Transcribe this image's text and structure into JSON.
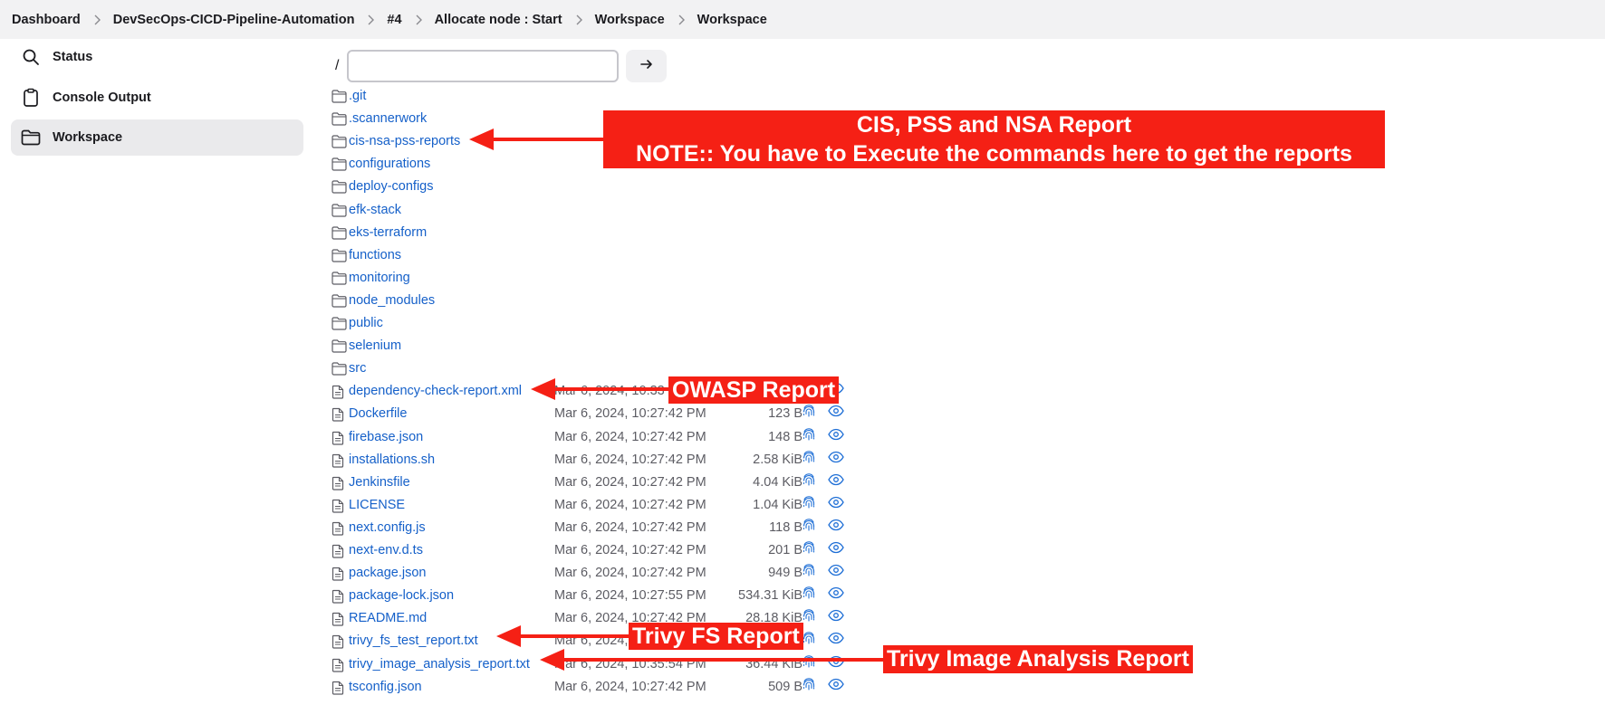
{
  "breadcrumb": [
    "Dashboard",
    "DevSecOps-CICD-Pipeline-Automation",
    "#4",
    "Allocate node : Start",
    "Workspace",
    "Workspace"
  ],
  "sidebar": {
    "items": [
      {
        "label": "Status",
        "icon": "search-icon"
      },
      {
        "label": "Console Output",
        "icon": "clipboard-icon"
      },
      {
        "label": "Workspace",
        "icon": "folder-icon",
        "active": true
      }
    ]
  },
  "path_bar": {
    "root": "/",
    "input_value": "",
    "go_icon": "arrow-right-icon"
  },
  "folders": [
    ".git",
    ".scannerwork",
    "cis-nsa-pss-reports",
    "configurations",
    "deploy-configs",
    "efk-stack",
    "eks-terraform",
    "functions",
    "monitoring",
    "node_modules",
    "public",
    "selenium",
    "src"
  ],
  "files": [
    {
      "name": "dependency-check-report.xml",
      "date": "Mar 6, 2024, 10:33",
      "size": ""
    },
    {
      "name": "Dockerfile",
      "date": "Mar 6, 2024, 10:27:42 PM",
      "size": "123 B"
    },
    {
      "name": "firebase.json",
      "date": "Mar 6, 2024, 10:27:42 PM",
      "size": "148 B"
    },
    {
      "name": "installations.sh",
      "date": "Mar 6, 2024, 10:27:42 PM",
      "size": "2.58 KiB"
    },
    {
      "name": "Jenkinsfile",
      "date": "Mar 6, 2024, 10:27:42 PM",
      "size": "4.04 KiB"
    },
    {
      "name": "LICENSE",
      "date": "Mar 6, 2024, 10:27:42 PM",
      "size": "1.04 KiB"
    },
    {
      "name": "next.config.js",
      "date": "Mar 6, 2024, 10:27:42 PM",
      "size": "118 B"
    },
    {
      "name": "next-env.d.ts",
      "date": "Mar 6, 2024, 10:27:42 PM",
      "size": "201 B"
    },
    {
      "name": "package.json",
      "date": "Mar 6, 2024, 10:27:42 PM",
      "size": "949 B"
    },
    {
      "name": "package-lock.json",
      "date": "Mar 6, 2024, 10:27:55 PM",
      "size": "534.31 KiB"
    },
    {
      "name": "README.md",
      "date": "Mar 6, 2024, 10:27:42 PM",
      "size": "28.18 KiB"
    },
    {
      "name": "trivy_fs_test_report.txt",
      "date": "Mar 6, 2024,",
      "size": ""
    },
    {
      "name": "trivy_image_analysis_report.txt",
      "date": "Mar 6, 2024, 10:35:54 PM",
      "size": "36.44 KiB"
    },
    {
      "name": "tsconfig.json",
      "date": "Mar 6, 2024, 10:27:42 PM",
      "size": "509 B"
    }
  ],
  "annotations": {
    "cis_title": "CIS, PSS and NSA Report",
    "cis_note": "NOTE:: You have to Execute the commands here to get the reports",
    "owasp": "OWASP Report",
    "trivy_fs": "Trivy FS Report",
    "trivy_image": "Trivy Image Analysis Report",
    "color": "#f52015"
  },
  "colors": {
    "link": "#1560c9",
    "breadcrumb_bg": "#f2f2f3",
    "active_bg": "#eaeaec"
  }
}
